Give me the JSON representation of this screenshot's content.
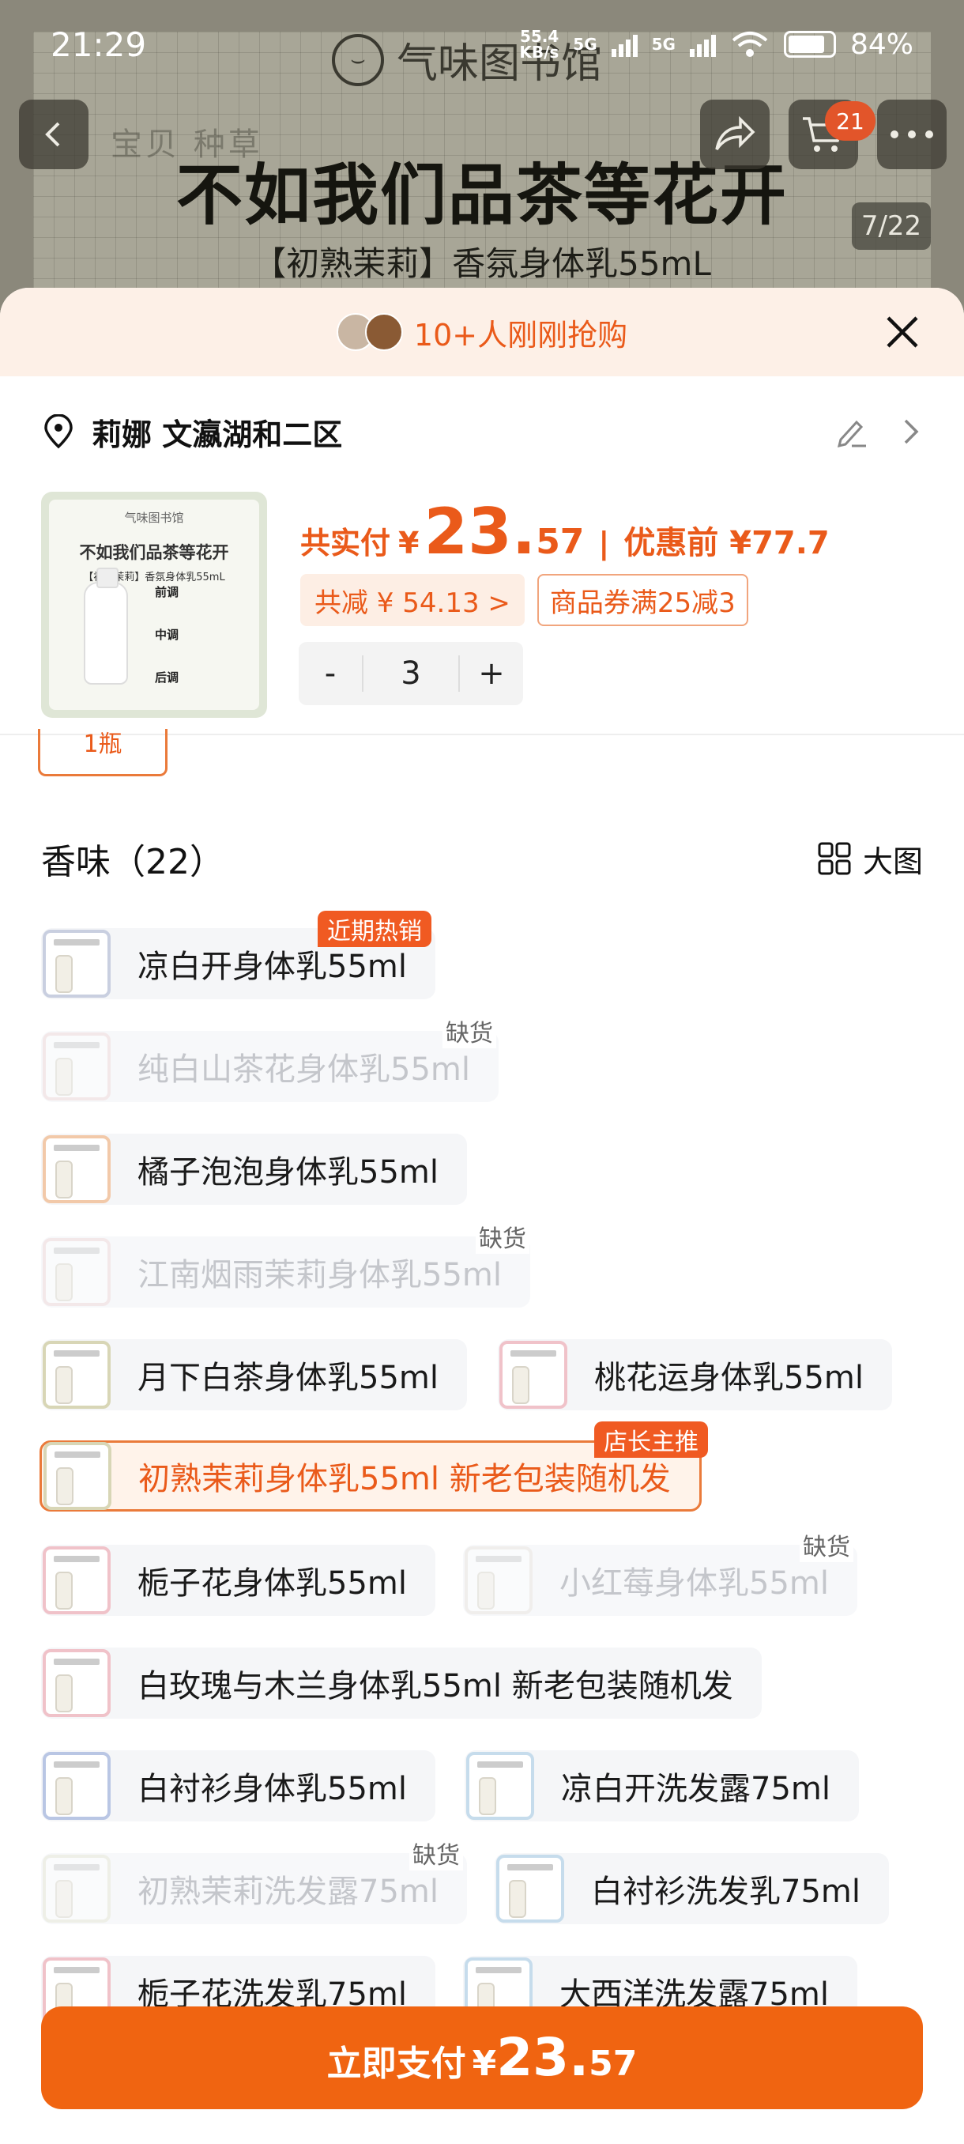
{
  "status_bar": {
    "time": "21:29",
    "net_speed": "55.4",
    "net_unit": "KB/s",
    "net1": "5G",
    "net2": "5G",
    "battery": "84%"
  },
  "background": {
    "brand": "气味图书馆",
    "tabs": "宝贝  种草",
    "headline": "不如我们品茶等花开",
    "subtitle": "【初熟茉莉】香氛身体乳55mL",
    "image_counter": "7/22",
    "cart_count": "21"
  },
  "banner": {
    "text": "10+人刚刚抢购"
  },
  "address": {
    "text": "莉娜 文瀛湖和二区"
  },
  "product": {
    "thumb_brand": "气味图书馆",
    "thumb_title": "不如我们品茶等花开",
    "thumb_sub": "【初熟茉莉】香氛身体乳55mL",
    "thumb_note1": "前调",
    "thumb_note2": "中调",
    "thumb_note3": "后调",
    "price_label": "共实付",
    "currency": "¥",
    "price_int": "23.",
    "price_dec": "57",
    "separator": "|",
    "orig_price": "优惠前 ¥77.7",
    "discount": "共减 ¥ 54.13 >",
    "coupon": "商品券满25减3",
    "qty_minus": "-",
    "qty_value": "3",
    "qty_plus": "+",
    "partial_chip": "1瓶"
  },
  "section": {
    "title": "香味（22）",
    "view_label": "大图"
  },
  "options": [
    {
      "label": "凉白开身体乳55ml",
      "state": "normal",
      "tag": "近期热销"
    },
    {
      "label": "纯白山茶花身体乳55ml",
      "state": "disabled",
      "oos": "缺货"
    },
    {
      "label": "橘子泡泡身体乳55ml",
      "state": "normal"
    },
    {
      "label": "江南烟雨茉莉身体乳55ml",
      "state": "disabled",
      "oos": "缺货"
    },
    {
      "label": "月下白茶身体乳55ml",
      "state": "normal"
    },
    {
      "label": "桃花运身体乳55ml",
      "state": "normal"
    },
    {
      "label": "初熟茉莉身体乳55ml 新老包装随机发",
      "state": "selected",
      "tag": "店长主推"
    },
    {
      "label": "栀子花身体乳55ml",
      "state": "normal"
    },
    {
      "label": "小红莓身体乳55ml",
      "state": "disabled",
      "oos": "缺货"
    },
    {
      "label": "白玫瑰与木兰身体乳55ml 新老包装随机发",
      "state": "normal"
    },
    {
      "label": "白衬衫身体乳55ml",
      "state": "normal"
    },
    {
      "label": "凉白开洗发露75ml",
      "state": "normal"
    },
    {
      "label": "初熟茉莉洗发露75ml",
      "state": "disabled",
      "oos": "缺货"
    },
    {
      "label": "白衬衫洗发乳75ml",
      "state": "normal"
    },
    {
      "label": "栀子花洗发乳75ml",
      "state": "normal"
    },
    {
      "label": "大西洋洗发露75ml",
      "state": "normal"
    }
  ],
  "pay_button": {
    "label": "立即支付",
    "currency": "¥",
    "price_int": "23.",
    "price_dec": "57"
  },
  "colors": {
    "accent": "#ea5a1a",
    "pay_button": "#f06411",
    "banner_bg": "#fdf0e7"
  }
}
